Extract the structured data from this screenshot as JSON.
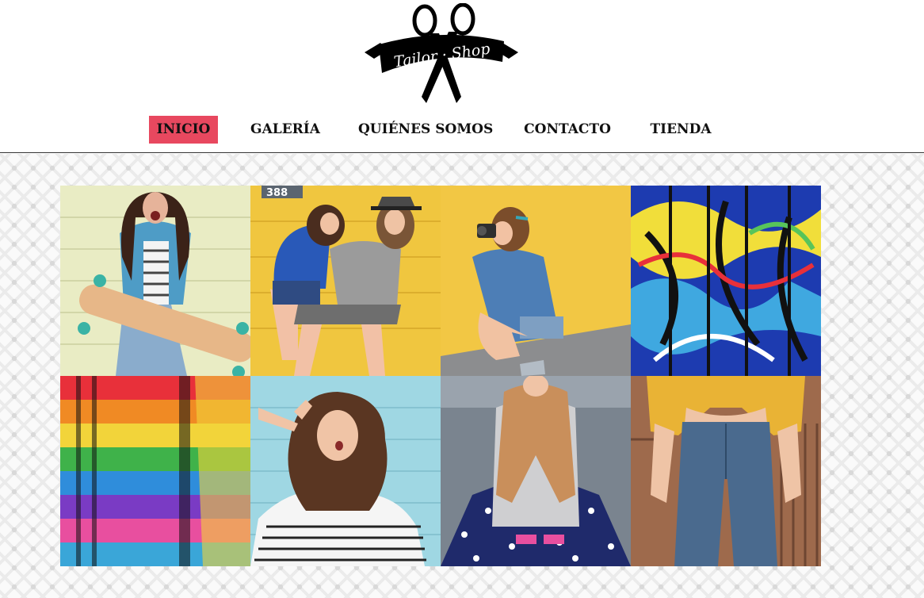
{
  "logo": {
    "text": "Tailor · Shop"
  },
  "nav": {
    "items": [
      {
        "label": "INICIO",
        "active": true
      },
      {
        "label": "GALERÍA",
        "active": false
      },
      {
        "label": "QUIÉNES SOMOS",
        "active": false
      },
      {
        "label": "CONTACTO",
        "active": false
      },
      {
        "label": "TIENDA",
        "active": false
      }
    ]
  },
  "colors": {
    "nav_active_bg": "#e8485f",
    "text": "#111111",
    "pattern": "#d9d9d9"
  },
  "gallery": {
    "photos": [
      {
        "subject": "girl-with-longboard-photo"
      },
      {
        "subject": "couple-yellow-wall-photo"
      },
      {
        "subject": "girl-with-camera-photo"
      },
      {
        "subject": "graffiti-wall-photo"
      },
      {
        "subject": "rainbow-striped-fabric-photo"
      },
      {
        "subject": "girl-peace-sign-photo"
      },
      {
        "subject": "girl-star-leggings-photo"
      },
      {
        "subject": "jeans-yellow-sweater-photo"
      }
    ]
  }
}
